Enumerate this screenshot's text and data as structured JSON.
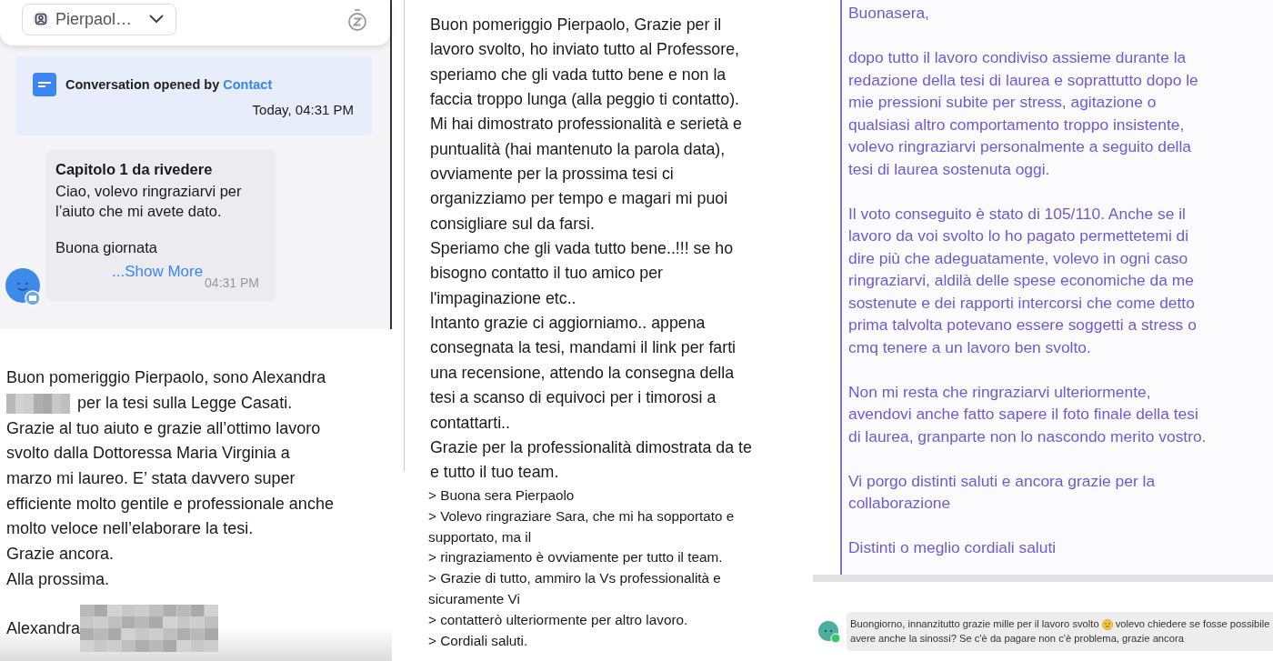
{
  "chat_panel": {
    "contact_selector": "Pierpaol…",
    "system_event": {
      "text": "Conversation opened by",
      "actor": "Contact",
      "time": "Today, 04:31 PM"
    },
    "message": {
      "title": "Capitolo 1 da rivedere",
      "paragraphs": [
        [
          "Ciao, volevo ringraziarvi per",
          "l’aiuto che mi avete dato."
        ],
        [
          "Buona giornata"
        ]
      ],
      "show_more": "...Show More",
      "time": "04:31 PM"
    }
  },
  "student_letter": {
    "lines": [
      {
        "text": "Buon pomeriggio Pierpaolo, sono Alexandra",
        "redacted": false
      },
      {
        "text": "per la tesi sulla Legge Casati.",
        "redacted": true
      },
      {
        "text": "Grazie al tuo aiuto e grazie all’ottimo lavoro",
        "redacted": false
      },
      {
        "text": "svolto dalla Dottoressa Maria Virginia a",
        "redacted": false
      },
      {
        "text": "marzo mi laureo. E’ stata davvero super",
        "redacted": false
      },
      {
        "text": "efficiente molto gentile e professionale anche",
        "redacted": false
      },
      {
        "text": "molto veloce nell’elaborare la tesi.",
        "redacted": false
      },
      {
        "text": "Grazie ancora.",
        "redacted": false
      },
      {
        "text": "Alla prossima.",
        "redacted": false
      }
    ],
    "signature": {
      "text": "Alexandra",
      "redacted": true
    }
  },
  "reply_letter": {
    "lines": [
      "Buon pomeriggio Pierpaolo, Grazie per il",
      "lavoro svolto, ho inviato tutto al Professore,",
      "speriamo che gli vada tutto bene e non la",
      "faccia troppo lunga (alla peggio ti contatto).",
      "Mi hai dimostrato professionalità e serietà e",
      "puntualità (hai mantenuto la parola data),",
      "ovviamente per la prossima tesi ci",
      "organizziamo per tempo e magari mi puoi",
      "consigliare sul da farsi.",
      "Speriamo che gli vada tutto bene..!!! se ho",
      "bisogno contatto il tuo amico per",
      "l'impaginazione etc..",
      "Intanto grazie ci aggiorniamo.. appena",
      "consegnata la tesi, mandami il link per farti",
      "una recensione, attendo la consegna della",
      "tesi a scanso di equivoci per i timorosi a",
      "contattarti..",
      "Grazie per la professionalità dimostrata da te",
      "e tutto il tuo team."
    ]
  },
  "quoted_email": {
    "lines": [
      "> Buona sera Pierpaolo",
      "> Volevo ringraziare Sara, che mi ha sopportato e",
      "supportato, ma il",
      "> ringraziamento è ovviamente per tutto il team.",
      "> Grazie di tutto, ammiro la Vs professionalità e",
      "sicuramente Vi",
      "> contatterò ulteriormente per altro lavoro.",
      "> Cordiali saluti."
    ]
  },
  "formal_letter": {
    "paragraphs": [
      [
        "Buonasera,"
      ],
      [
        "dopo tutto il lavoro condiviso assieme durante la",
        "redazione della tesi di laurea e soprattutto dopo le",
        "mie pressioni subite per stress, agitazione o",
        "qualsiasi altro comportamento troppo insistente,",
        "volevo ringraziarvi personalmente a seguito della",
        "tesi di laurea sostenuta oggi."
      ],
      [
        "Il voto conseguito è stato di 105/110. Anche se il",
        "lavoro da voi svolto lo ho pagato permettetemi di",
        "dire più che adeguatamente, volevo in ogni caso",
        "ringraziarvi, aldilà delle spese economiche da me",
        "sostenute e dei rapporti intercorsi che come detto",
        "prima talvolta potevano essere soggetti a stress o",
        "cmq tenere a un lavoro ben svolto."
      ],
      [
        "Non mi resta che ringraziarvi ulteriormente,",
        "avendovi anche fatto sapere il foto finale della tesi",
        "di laurea, granparte non lo nascondo merito vostro."
      ],
      [
        "Vi porgo distinti saluti e ancora grazie per la",
        "collaborazione"
      ],
      [
        "Distinti o meglio cordiali saluti"
      ]
    ]
  },
  "chat_message": {
    "text_before_emoji": "Buongiorno, innanzitutto grazie mille per il lavoro svolto",
    "text_after_emoji": "volevo chiedere se fosse possibile",
    "second_line": "avere anche la sinossi? Se c'è da pagare non c'è problema, grazie ancora"
  }
}
